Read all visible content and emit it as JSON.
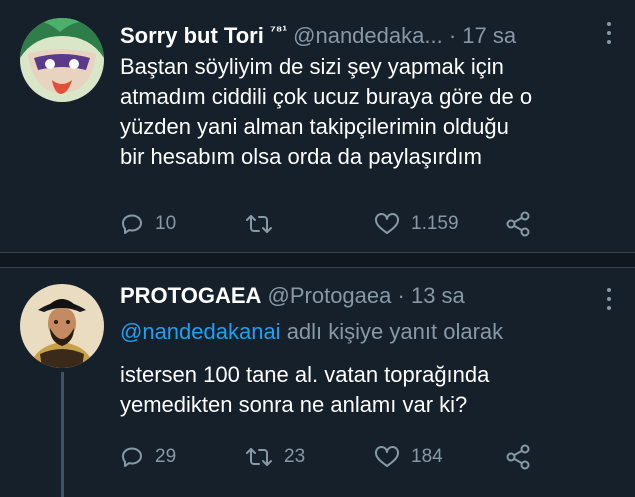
{
  "tweets": [
    {
      "name": "Sorry but Tori",
      "name_badge": "⁷⁸¹",
      "handle": "@nandedaka...",
      "separator": "·",
      "time": "17 sa",
      "body_lines": [
        "Baştan söyliyim de sizi şey yapmak için",
        "atmadım ciddili çok ucuz buraya göre de o",
        "yüzden yani alman takipçilerimin olduğu",
        "bir hesabım olsa orda da paylaşırdım"
      ],
      "reply_count": "10",
      "retweet_count": "",
      "like_count": "1.159"
    },
    {
      "name": "PROTOGAEA",
      "handle": "@Protogaea",
      "separator": "·",
      "time": "13 sa",
      "reply_to_mention": "@nandedakanai",
      "reply_to_suffix": " adlı kişiye yanıt olarak",
      "body_lines": [
        "istersen 100 tane al. vatan toprağında",
        "yemedikten sonra ne anlamı var ki?"
      ],
      "reply_count": "29",
      "retweet_count": "23",
      "like_count": "184"
    }
  ],
  "colors": {
    "background": "#15202b",
    "secondary_text": "#8899a6",
    "link": "#1da1f2",
    "divider": "#10171e"
  },
  "icons": [
    "reply-icon",
    "retweet-icon",
    "like-icon",
    "share-icon",
    "more-icon"
  ]
}
